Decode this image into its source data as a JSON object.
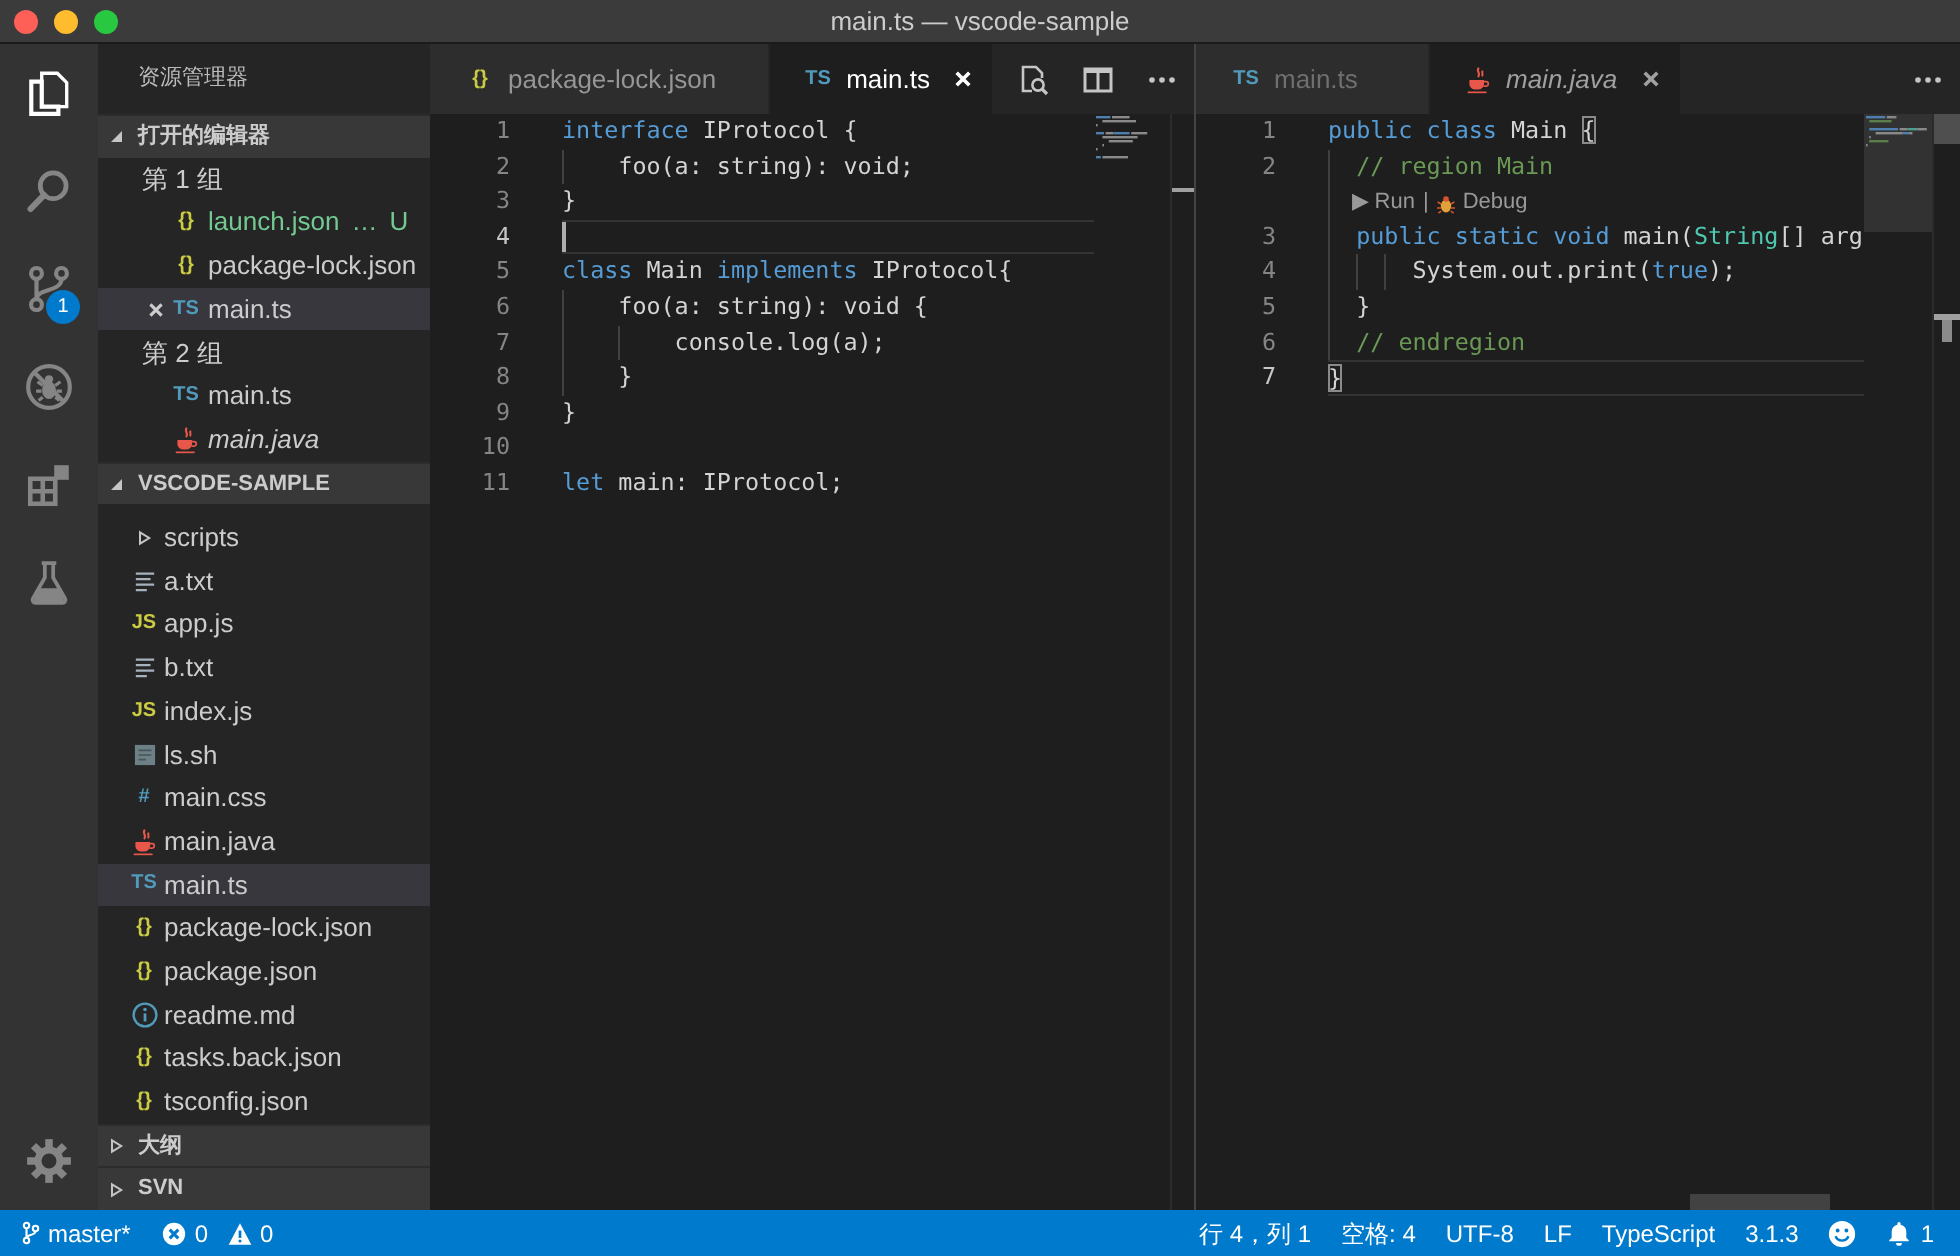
{
  "window": {
    "title": "main.ts — vscode-sample"
  },
  "activity_bar": {
    "items": [
      {
        "kind": "explorer",
        "selected": true
      },
      {
        "kind": "search",
        "selected": false
      },
      {
        "kind": "source_control",
        "selected": false,
        "badge": "1"
      },
      {
        "kind": "debug",
        "selected": false
      },
      {
        "kind": "extensions",
        "selected": false
      },
      {
        "kind": "test",
        "selected": false
      }
    ],
    "bottom": [
      {
        "kind": "settings"
      }
    ]
  },
  "sidebar": {
    "title": "资源管理器",
    "sections": [
      {
        "kind": "open_editors",
        "title": "打开的编辑器",
        "expanded": true,
        "groups": [
          {
            "title": "第 1 组",
            "items": [
              {
                "name": "launch.json",
                "description": "…",
                "decoration": "U",
                "untracked": true,
                "kind": "json",
                "icon_text": "{}",
                "selected": false,
                "preview": false
              },
              {
                "name": "package-lock.json",
                "untracked": false,
                "kind": "json",
                "icon_text": "{}",
                "selected": false,
                "preview": false
              },
              {
                "name": "main.ts",
                "untracked": false,
                "kind": "ts",
                "icon_text": "TS",
                "selected": true,
                "preview": false
              }
            ]
          },
          {
            "title": "第 2 组",
            "items": [
              {
                "name": "main.ts",
                "untracked": false,
                "kind": "ts",
                "icon_text": "TS",
                "selected": false,
                "preview": false
              },
              {
                "name": "main.java",
                "untracked": false,
                "kind": "java",
                "selected": false,
                "preview": true
              }
            ]
          }
        ]
      },
      {
        "kind": "folder",
        "title": "VSCODE-SAMPLE",
        "expanded": true,
        "items": [
          {
            "name": "scripts",
            "kind": "folder",
            "expanded": false,
            "selected": false
          },
          {
            "name": "a.txt",
            "kind": "txt",
            "selected": false
          },
          {
            "name": "app.js",
            "kind": "js",
            "icon_text": "JS",
            "selected": false
          },
          {
            "name": "b.txt",
            "kind": "txt",
            "selected": false
          },
          {
            "name": "index.js",
            "kind": "js",
            "icon_text": "JS",
            "selected": false
          },
          {
            "name": "ls.sh",
            "kind": "shell",
            "selected": false
          },
          {
            "name": "main.css",
            "kind": "css",
            "icon_text": "#",
            "selected": false
          },
          {
            "name": "main.java",
            "kind": "java",
            "selected": false
          },
          {
            "name": "main.ts",
            "kind": "ts",
            "icon_text": "TS",
            "selected": true
          },
          {
            "name": "package-lock.json",
            "kind": "json",
            "icon_text": "{}",
            "selected": false
          },
          {
            "name": "package.json",
            "kind": "json",
            "icon_text": "{}",
            "selected": false
          },
          {
            "name": "readme.md",
            "kind": "markdown",
            "selected": false
          },
          {
            "name": "tasks.back.json",
            "kind": "json",
            "icon_text": "{}",
            "selected": false
          },
          {
            "name": "tsconfig.json",
            "kind": "json",
            "icon_text": "{}",
            "selected": false
          }
        ]
      },
      {
        "kind": "panel",
        "title": "大纲",
        "expanded": false
      },
      {
        "kind": "panel",
        "title": "SVN",
        "expanded": false
      }
    ]
  },
  "editor_groups": [
    {
      "focused": true,
      "tabs": [
        {
          "label": "package-lock.json",
          "kind": "json",
          "icon_text": "{}",
          "selected": false,
          "preview": false
        },
        {
          "label": "main.ts",
          "kind": "ts",
          "icon_text": "TS",
          "selected": true,
          "preview": false
        }
      ],
      "actions": [
        {
          "kind": "open_changes"
        },
        {
          "kind": "split"
        },
        {
          "kind": "more"
        }
      ],
      "lines": [
        {
          "number": "1",
          "current": false,
          "tokens": [
            {
              "text": "interface",
              "kind": "keyword"
            },
            {
              "text": " IProtocol {",
              "kind": "plain"
            }
          ]
        },
        {
          "number": "2",
          "current": false,
          "tokens": [
            {
              "text": "    foo(a: string): void;",
              "kind": "plain"
            }
          ]
        },
        {
          "number": "3",
          "current": false,
          "tokens": [
            {
              "text": "}",
              "kind": "plain"
            }
          ]
        },
        {
          "number": "4",
          "current": true
        },
        {
          "number": "5",
          "current": false,
          "tokens": [
            {
              "text": "class",
              "kind": "keyword"
            },
            {
              "text": " Main ",
              "kind": "plain"
            },
            {
              "text": "implements",
              "kind": "keyword"
            },
            {
              "text": " IProtocol{",
              "kind": "plain"
            }
          ]
        },
        {
          "number": "6",
          "current": false,
          "tokens": [
            {
              "text": "    foo(a: string): void {",
              "kind": "plain"
            }
          ]
        },
        {
          "number": "7",
          "current": false,
          "tokens": [
            {
              "text": "        console.log(a);",
              "kind": "plain"
            }
          ]
        },
        {
          "number": "8",
          "current": false,
          "tokens": [
            {
              "text": "    }",
              "kind": "plain"
            }
          ]
        },
        {
          "number": "9",
          "current": false,
          "tokens": [
            {
              "text": "}",
              "kind": "plain"
            }
          ]
        },
        {
          "number": "10",
          "current": false
        },
        {
          "number": "11",
          "current": false,
          "tokens": [
            {
              "text": "let",
              "kind": "keyword"
            },
            {
              "text": " main: IProtocol;",
              "kind": "plain"
            }
          ]
        }
      ]
    },
    {
      "focused": false,
      "tabs": [
        {
          "label": "main.ts",
          "kind": "ts",
          "icon_text": "TS",
          "selected": false,
          "preview": false
        },
        {
          "label": "main.java",
          "kind": "java",
          "selected": true,
          "preview": true
        }
      ],
      "actions": [
        {
          "kind": "more"
        }
      ],
      "lines": [
        {
          "number": "1",
          "current": false,
          "tokens": [
            {
              "text": "public class",
              "kind": "keyword"
            },
            {
              "text": " Main ",
              "kind": "plain"
            },
            {
              "text": "{",
              "kind": "bracket"
            }
          ]
        },
        {
          "number": "2",
          "current": false,
          "tokens": [
            {
              "text": "  // region Main",
              "kind": "comment"
            }
          ]
        },
        {
          "number": "3",
          "current": false,
          "codelens": {
            "items": [
              {
                "label": "▶ Run",
                "kind": "run"
              },
              {
                "label": "Debug",
                "kind": "debug"
              }
            ],
            "separator": "|"
          },
          "tokens": [
            {
              "text": "  public static void",
              "kind": "keyword"
            },
            {
              "text": " main(",
              "kind": "plain"
            },
            {
              "text": "String",
              "kind": "type"
            },
            {
              "text": "[] arg",
              "kind": "plain"
            }
          ]
        },
        {
          "number": "4",
          "current": false,
          "tokens": [
            {
              "text": "      System.out.print(",
              "kind": "plain"
            },
            {
              "text": "true",
              "kind": "keyword"
            },
            {
              "text": ");",
              "kind": "plain"
            }
          ]
        },
        {
          "number": "5",
          "current": false,
          "tokens": [
            {
              "text": "  }",
              "kind": "plain"
            }
          ]
        },
        {
          "number": "6",
          "current": false,
          "tokens": [
            {
              "text": "  // endregion",
              "kind": "comment"
            }
          ]
        },
        {
          "number": "7",
          "current": true,
          "tokens": [
            {
              "text": "}",
              "kind": "bracket"
            }
          ]
        }
      ]
    }
  ],
  "status_bar": {
    "left": [
      {
        "kind": "branch",
        "text": "master*"
      },
      {
        "kind": "errors",
        "text": "0"
      },
      {
        "kind": "warnings",
        "text": "0"
      }
    ],
    "right": [
      {
        "kind": "text",
        "text": "行 4，列 1"
      },
      {
        "kind": "text",
        "text": "空格: 4"
      },
      {
        "kind": "text",
        "text": "UTF-8"
      },
      {
        "kind": "text",
        "text": "LF"
      },
      {
        "kind": "text",
        "text": "TypeScript"
      },
      {
        "kind": "text",
        "text": "3.1.3"
      },
      {
        "kind": "feedback"
      },
      {
        "kind": "notifications",
        "text": "1"
      }
    ]
  }
}
